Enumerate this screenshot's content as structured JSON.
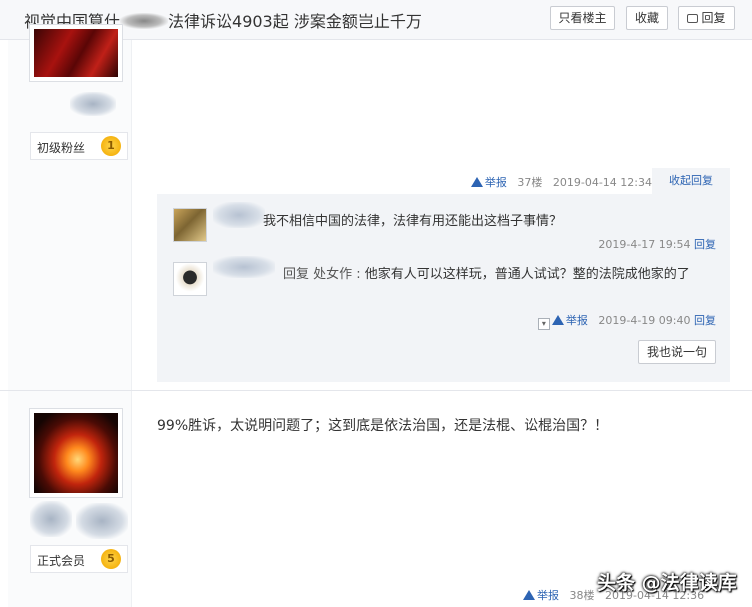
{
  "header": {
    "title_before": "视觉中国算什",
    "title_after": "法律诉讼4903起 涉案金额岂止千万",
    "only_op": "只看楼主",
    "favorite": "收藏",
    "reply": "回复"
  },
  "floor1": {
    "rank_label": "初级粉丝",
    "rank_level": "1",
    "report": "举报",
    "floor": "37楼",
    "time": "2019-04-14 12:34",
    "collapse": "收起回复",
    "comments": [
      {
        "text": "我不相信中国的法律，法律有用还能出这档子事情？",
        "time": "2019-4-17 19:54",
        "reply": "回复"
      },
      {
        "lead": "回复 处女作 : ",
        "text": "他家有人可以这样玩，普通人试试？整的法院成他家的了",
        "report": "举报",
        "time": "2019-4-19 09:40",
        "reply": "回复"
      }
    ],
    "say_button": "我也说一句"
  },
  "floor2": {
    "rank_label": "正式会员",
    "rank_level": "5",
    "post_text": "99%胜诉，太说明问题了；这到底是依法治国，还是法棍、讼棍治国？！",
    "report": "举报",
    "floor": "38楼",
    "time": "2019-04-14 12:36"
  },
  "watermark": "头条 @法律读库"
}
